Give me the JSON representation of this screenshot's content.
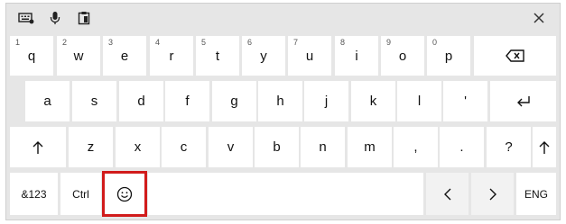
{
  "toolbar": {
    "icons": [
      "keyboard-settings-icon",
      "microphone-icon",
      "clipboard-icon"
    ],
    "close_icon": "close-icon"
  },
  "rows": {
    "row1": {
      "keys": [
        {
          "label": "q",
          "hint": "1"
        },
        {
          "label": "w",
          "hint": "2"
        },
        {
          "label": "e",
          "hint": "3"
        },
        {
          "label": "r",
          "hint": "4"
        },
        {
          "label": "t",
          "hint": "5"
        },
        {
          "label": "y",
          "hint": "6"
        },
        {
          "label": "u",
          "hint": "7"
        },
        {
          "label": "i",
          "hint": "8"
        },
        {
          "label": "o",
          "hint": "9"
        },
        {
          "label": "p",
          "hint": "0"
        }
      ],
      "backspace_icon": "backspace-icon"
    },
    "row2": {
      "keys": [
        "a",
        "s",
        "d",
        "f",
        "g",
        "h",
        "j",
        "k",
        "l",
        "'"
      ],
      "enter_icon": "enter-icon"
    },
    "row3": {
      "shift_icon": "shift-icon",
      "keys": [
        "z",
        "x",
        "c",
        "v",
        "b",
        "n",
        "m",
        ",",
        ".",
        "?"
      ]
    },
    "row4": {
      "symbols": "&123",
      "ctrl": "Ctrl",
      "emoji_icon": "emoji-icon",
      "left_icon": "chevron-left-icon",
      "right_icon": "chevron-right-icon",
      "lang": "ENG"
    }
  },
  "colors": {
    "panel": "#e6e6e6",
    "key": "#ffffff",
    "highlight": "#d11b1b"
  }
}
